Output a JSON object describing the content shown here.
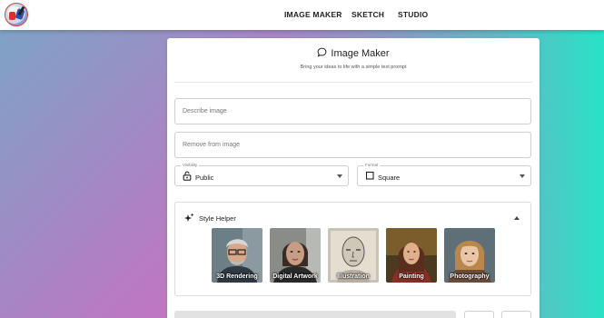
{
  "nav": {
    "links": [
      "IMAGE MAKER",
      "SKETCH",
      "STUDIO"
    ]
  },
  "card": {
    "title": "Image Maker",
    "title_icon": "chat-bubble-icon",
    "subtitle": "Bring your ideas to life with a simple text prompt"
  },
  "inputs": {
    "describe_placeholder": "Describe image",
    "remove_placeholder": "Remove from image"
  },
  "visibility": {
    "label": "Visibility",
    "value": "Public",
    "icon": "lock-open-icon"
  },
  "format": {
    "label": "Format",
    "value": "Square",
    "icon": "square-icon"
  },
  "style_helper": {
    "title": "Style Helper",
    "icon": "sparkle-icon",
    "styles": [
      "3D Rendering",
      "Digital Artwork",
      "Illustration",
      "Painting",
      "Photography"
    ]
  }
}
